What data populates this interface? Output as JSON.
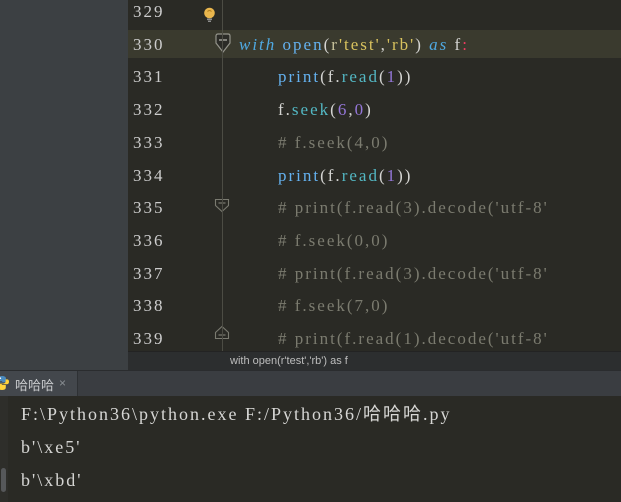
{
  "colors": {
    "editor_bg": "#2a2a25",
    "panel_bg": "#3c4043",
    "caret_row": "#3a3a2e",
    "line_number": "#cdcdcd",
    "separator": "#4c4c44",
    "kw": "#4fa9e2",
    "fn": "#64b1ef",
    "mth": "#53b7c3",
    "num": "#9577d9",
    "str": "#d8c25e",
    "strp": "#c9c49e",
    "cm": "#7b7b6f",
    "pl": "#d4d4d2",
    "colon": "#f23b60",
    "tooltip_bg": "#2c2e2f",
    "tooltip_text": "#bdbdbd",
    "tabbar_bg": "#3a3d41",
    "tab_bg": "#43474c",
    "tab_text": "#c9cbcd",
    "tab_close": "#8a8f93",
    "console_text": "#d6d6d4",
    "bulb": "#e9b64d",
    "python_blue": "#4b8bbe",
    "python_yellow": "#ffd43b",
    "scroll_thumb": "#56585a"
  },
  "editor": {
    "context_hint": "with open(r'test','rb') as f",
    "lines": [
      {
        "no": "329",
        "bulb": true,
        "tokens": []
      },
      {
        "no": "330",
        "current": true,
        "fold": "collapsed",
        "tokens": [
          {
            "c": "kw",
            "t": "with "
          },
          {
            "c": "fn",
            "t": "open"
          },
          {
            "c": "pl",
            "t": "("
          },
          {
            "c": "strp",
            "t": "r"
          },
          {
            "c": "str",
            "t": "'test'"
          },
          {
            "c": "pl",
            "t": ","
          },
          {
            "c": "str",
            "t": "'rb'"
          },
          {
            "c": "pl",
            "t": ") "
          },
          {
            "c": "kw",
            "t": "as "
          },
          {
            "c": "pl",
            "t": "f"
          },
          {
            "c": "colon",
            "t": ":"
          }
        ]
      },
      {
        "no": "331",
        "indent": 1,
        "tokens": [
          {
            "c": "fn",
            "t": "print"
          },
          {
            "c": "pl",
            "t": "(f."
          },
          {
            "c": "mth",
            "t": "read"
          },
          {
            "c": "pl",
            "t": "("
          },
          {
            "c": "num",
            "t": "1"
          },
          {
            "c": "pl",
            "t": "))"
          }
        ]
      },
      {
        "no": "332",
        "indent": 1,
        "tokens": [
          {
            "c": "pl",
            "t": "f."
          },
          {
            "c": "mth",
            "t": "seek"
          },
          {
            "c": "pl",
            "t": "("
          },
          {
            "c": "num",
            "t": "6"
          },
          {
            "c": "pl",
            "t": ","
          },
          {
            "c": "num",
            "t": "0"
          },
          {
            "c": "pl",
            "t": ")"
          }
        ]
      },
      {
        "no": "333",
        "indent": 1,
        "tokens": [
          {
            "c": "cm",
            "t": "# f.seek(4,0)"
          }
        ]
      },
      {
        "no": "334",
        "indent": 1,
        "tokens": [
          {
            "c": "fn",
            "t": "print"
          },
          {
            "c": "pl",
            "t": "(f."
          },
          {
            "c": "mth",
            "t": "read"
          },
          {
            "c": "pl",
            "t": "("
          },
          {
            "c": "num",
            "t": "1"
          },
          {
            "c": "pl",
            "t": "))"
          }
        ]
      },
      {
        "no": "335",
        "indent": 1,
        "fold": "start",
        "tokens": [
          {
            "c": "cm",
            "t": "# print(f.read(3).decode('utf-8'"
          }
        ]
      },
      {
        "no": "336",
        "indent": 1,
        "tokens": [
          {
            "c": "cm",
            "t": "# f.seek(0,0)"
          }
        ]
      },
      {
        "no": "337",
        "indent": 1,
        "tokens": [
          {
            "c": "cm",
            "t": "# print(f.read(3).decode('utf-8'"
          }
        ]
      },
      {
        "no": "338",
        "indent": 1,
        "tokens": [
          {
            "c": "cm",
            "t": "# f.seek(7,0)"
          }
        ]
      },
      {
        "no": "339",
        "indent": 1,
        "fold": "end",
        "tokens": [
          {
            "c": "cm",
            "t": "# print(f.read(1).decode('utf-8'"
          }
        ]
      }
    ]
  },
  "console": {
    "tab_label": "哈哈哈",
    "tab_close": "×",
    "lines": [
      "F:\\Python36\\python.exe F:/Python36/哈哈哈.py",
      "b'\\xe5'",
      "b'\\xbd'"
    ]
  }
}
